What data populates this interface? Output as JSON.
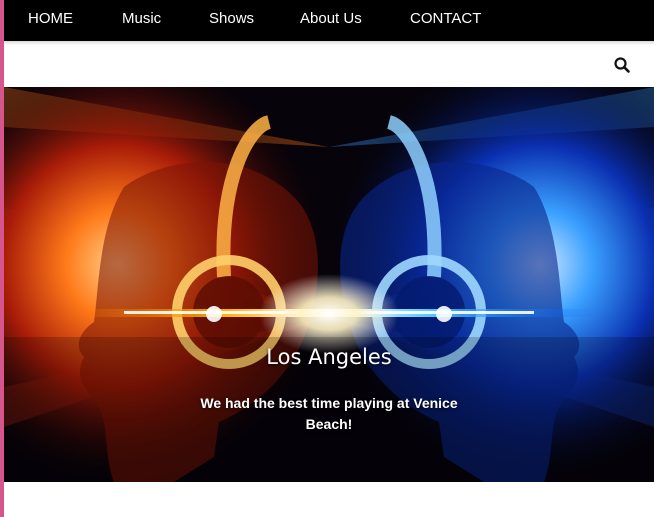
{
  "nav": {
    "items": [
      {
        "label": "HOME"
      },
      {
        "label": "Music"
      },
      {
        "label": "Shows"
      },
      {
        "label": "About Us"
      },
      {
        "label": "CONTACT"
      }
    ]
  },
  "search": {
    "icon": "search-icon"
  },
  "hero": {
    "image": "hero-image-headphones",
    "caption_title": "Los Angeles",
    "caption_text": "We had the best time playing at Venice Beach!"
  },
  "colors": {
    "nav_bg": "#000000",
    "nav_text": "#ffffff",
    "accent_edge": "#d6558c"
  }
}
